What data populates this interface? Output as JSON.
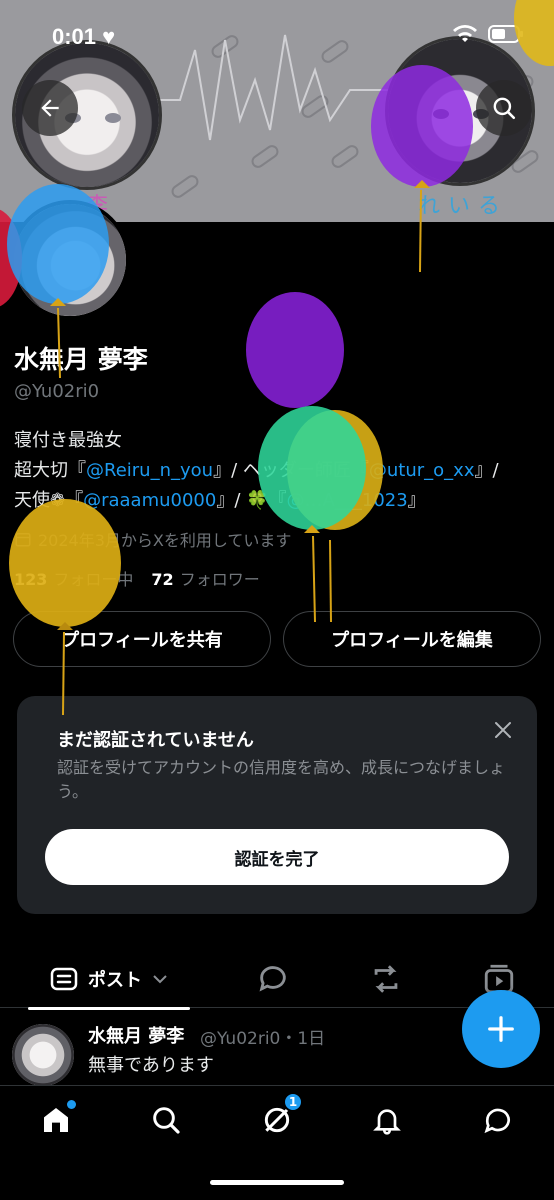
{
  "status_bar": {
    "time": "0:01"
  },
  "banner": {
    "text_left": "李",
    "text_right": "れいる"
  },
  "profile": {
    "name": "水無月 夢李",
    "handle": "@Yu02ri0",
    "bio_line1": "寝付き最強女",
    "bio_line2_a": "超大切『",
    "bio_line2_link1": "@Reiru_n_you",
    "bio_line2_b": "』/ ヘッダー師匠『",
    "bio_line2_link2": "@utur_o_xx",
    "bio_line2_c": "』/",
    "bio_line3_a": "天使❁『",
    "bio_line3_link1": "@raaamu0000",
    "bio_line3_b": "』/ 🍀『",
    "bio_line3_link2": "@…A___1023",
    "bio_line3_c": "』",
    "joined": "2024年3月からXを利用しています",
    "following_count": "123",
    "following_label": "フォロー中",
    "followers_count": "72",
    "followers_label": "フォロワー"
  },
  "buttons": {
    "share_profile": "プロフィールを共有",
    "edit_profile": "プロフィールを編集"
  },
  "verification": {
    "title": "まだ認証されていません",
    "description": "認証を受けてアカウントの信用度を高め、成長につなげましょう。",
    "button": "認証を完了"
  },
  "tabs": {
    "posts_label": "ポスト"
  },
  "post": {
    "author": "水無月 夢李",
    "meta": "@Yu02ri0・1日",
    "text": "無事であります"
  },
  "bottom_nav": {
    "messages_badge": "1"
  },
  "colors": {
    "accent": "#1d9bf0",
    "background": "#000000",
    "banner_text_left": "#c85bb5",
    "banner_text_right": "#3fa3d6"
  }
}
